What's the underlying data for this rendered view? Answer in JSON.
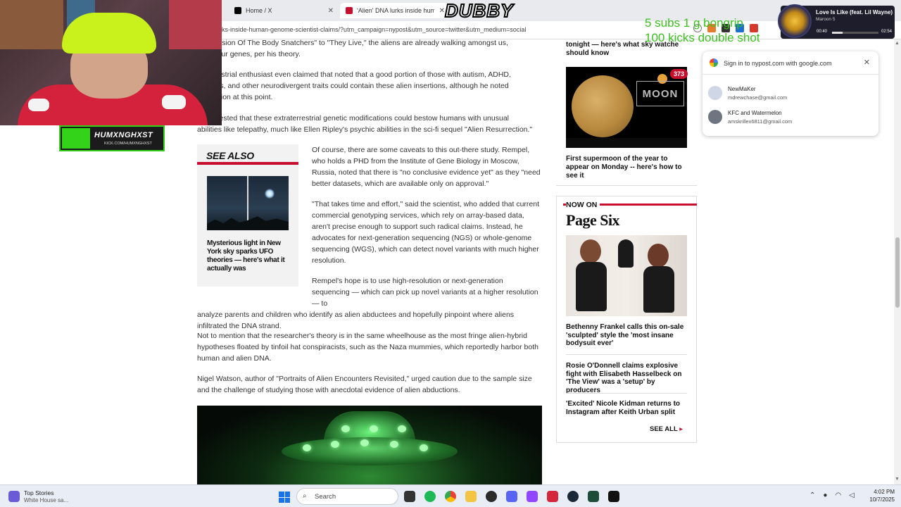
{
  "browser": {
    "tabs": [
      {
        "label": "Home / X",
        "active": false
      },
      {
        "label": "'Alien' DNA lurks inside human",
        "active": true
      }
    ],
    "url": "rks-inside-human-genome-scientist-claims/?utm_campaign=nypost&utm_source=twitter&utm_medium=social"
  },
  "article": {
    "p1a": "m \"Invasion Of The Body Snatchers\" to \"They Live,\" the aliens are already walking amongst us,",
    "p1b": "laged our genes, per his theory.",
    "p2a": "ra-terrestrial enthusiast even claimed that noted that a good portion of those with autism, ADHD,",
    "p2b": "berger's, and other neurodivergent traits could contain these alien insertions, although he noted",
    "p2c": "peculation at this point.",
    "p3a": "n suggested that these extraterrestrial genetic modifications could bestow humans with unusual",
    "p3b": "abilities like telepathy, much like Ellen Ripley's psychic abilities in the sci-fi sequel \"Alien Resurrection.\"",
    "p4": "Of course, there are some caveats to this out-there study. Rempel, who holds a PHD from the Institute of Gene Biology in Moscow, Russia, noted that there is \"no conclusive evidence yet\" as they \"need better datasets, which are available only on approval.\"",
    "p5": "\"That takes time and effort,\" said the scientist, who added that current commercial genotyping services, which rely on array-based data, aren't precise enough to support such radical claims. Instead, he advocates for next-generation sequencing (NGS) or whole-genome sequencing (WGS), which can detect novel variants with much higher resolution.",
    "p6a": "Rempel's hope is to use high-resolution or next-generation sequencing — which can pick up novel variants at a higher resolution — to",
    "p6b": "analyze parents and children who identify as alien abductees and hopefully pinpoint where aliens infiltrated the DNA strand.",
    "p7": "Not to mention that the researcher's theory is in the same wheelhouse as the most fringe alien-hybrid hypotheses floated by tinfoil hat conspiracists, such as the Naza mummies, which reportedly harbor both human and alien DNA.",
    "p8": "Nigel Watson, author of \"Portraits of Alien Encounters Revisited,\" urged caution due to the sample size and the challenge of studying those with anecdotal evidence of alien abductions."
  },
  "see_also": {
    "title": "SEE ALSO",
    "caption": "Mysterious light in New York sky sparks UFO theories — here's what it actually was"
  },
  "rail": {
    "top_fragment_a": "tonight — here's what sky watche",
    "top_fragment_b": "should know",
    "moon_word": "MOON",
    "moon_badge": "373",
    "moon_caption": "First supermoon of the year to appear on Monday -- here's how to see it",
    "now_on": "NOW ON",
    "page_six": "Page Six",
    "items": [
      "Bethenny Frankel calls this on-sale 'sculpted' style the 'most insane bodysuit ever'",
      "Rosie O'Donnell claims explosive fight with Elisabeth Hasselbeck on 'The View' was a 'setup' by producers",
      "'Excited' Nicole Kidman returns to Instagram after Keith Urban split"
    ],
    "see_all": "SEE ALL"
  },
  "google_popup": {
    "title": "Sign in to nypost.com with google.com",
    "accounts": [
      {
        "name": "NewMaKer",
        "email": "mdrewchase@gmail.com"
      },
      {
        "name": "KFC and Watermelon",
        "email": "amskrillex6811@gmail.com"
      }
    ]
  },
  "stream": {
    "brand_name": "HUMXNGHXST",
    "brand_url": "KICK.COM/HUMXNGHXST",
    "dubby": "DUBBY",
    "overlay_line1": "5 subs 1 g bongrip",
    "overlay_line2": "100 kicks double shot",
    "music": {
      "song": "Love Is Like (feat. Lil Wayne)",
      "artist": "Maroon 5",
      "elapsed": "00:40",
      "total": "02:54",
      "progress": 0.23
    }
  },
  "taskbar": {
    "weather_title": "Top Stories",
    "weather_sub": "White House sa...",
    "search": "Search",
    "time": "4:02 PM",
    "date": "10/7/2025"
  },
  "colors": {
    "brand_red": "#c8102e",
    "stream_green": "#32d319",
    "overlay_green": "#3ac11e"
  }
}
